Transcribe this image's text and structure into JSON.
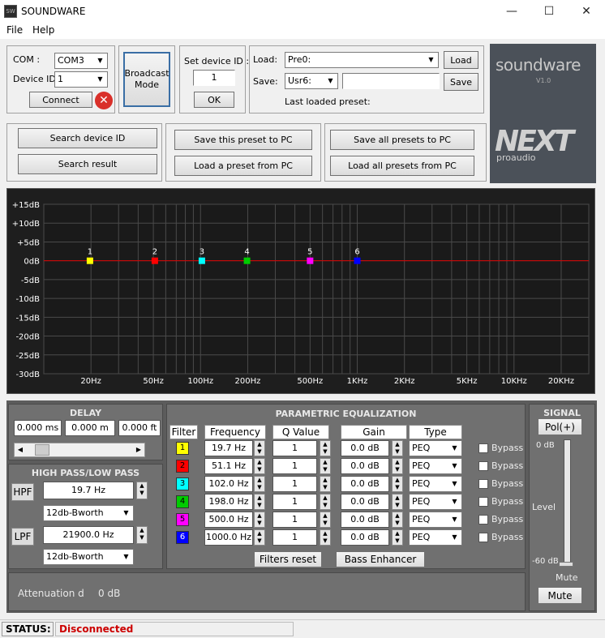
{
  "window": {
    "title": "SOUNDWARE",
    "minimize": "—",
    "maximize": "☐",
    "close": "✕",
    "icon": "app-icon"
  },
  "menu": {
    "file": "File",
    "help": "Help"
  },
  "connection": {
    "com_label": "COM :",
    "com_value": "COM3",
    "device_id_label": "Device ID:",
    "device_id_value": "1",
    "connect_label": "Connect",
    "broadcast_label": "Broadcast Mode"
  },
  "set_device": {
    "label": "Set device ID :",
    "value": "1",
    "ok": "OK"
  },
  "presets": {
    "load_label": "Load:",
    "load_value": "Pre0:",
    "load_btn": "Load",
    "save_label": "Save:",
    "save_value": "Usr6:",
    "save_name": "",
    "save_btn": "Save",
    "last_loaded": "Last loaded preset:"
  },
  "logo": {
    "brand": "soundware",
    "version": "V1.0",
    "next": "NEXT",
    "proaudio": "proaudio"
  },
  "actions": {
    "search_id": "Search device ID",
    "search_result": "Search result",
    "save_preset_pc": "Save this preset to PC",
    "load_preset_pc": "Load a preset from PC",
    "save_all_pc": "Save all presets to PC",
    "load_all_pc": "Load all presets from PC"
  },
  "chart_data": {
    "type": "line",
    "xscale": "log",
    "xlim": [
      10,
      30000
    ],
    "ylim": [
      -30,
      15
    ],
    "grid": true,
    "y_ticks": [
      "+15dB",
      "+10dB",
      "+5dB",
      "0dB",
      "-5dB",
      "-10dB",
      "-15dB",
      "-20dB",
      "-25dB",
      "-30dB"
    ],
    "y_tick_values": [
      15,
      10,
      5,
      0,
      -5,
      -10,
      -15,
      -20,
      -25,
      -30
    ],
    "x_ticks": [
      "20Hz",
      "50Hz",
      "100Hz",
      "200Hz",
      "500Hz",
      "1KHz",
      "2KHz",
      "5KHz",
      "10KHz",
      "20KHz"
    ],
    "x_tick_values": [
      20,
      50,
      100,
      200,
      500,
      1000,
      2000,
      5000,
      10000,
      20000
    ],
    "curve": {
      "color": "#dd0000",
      "values": [
        0,
        0
      ]
    },
    "points": [
      {
        "label": "1",
        "freq": 19.7,
        "gain": 0,
        "color": "#ffff00"
      },
      {
        "label": "2",
        "freq": 51.1,
        "gain": 0,
        "color": "#ff0000"
      },
      {
        "label": "3",
        "freq": 102.0,
        "gain": 0,
        "color": "#00ffff"
      },
      {
        "label": "4",
        "freq": 198.0,
        "gain": 0,
        "color": "#00cc00"
      },
      {
        "label": "5",
        "freq": 500.0,
        "gain": 0,
        "color": "#ff00ff"
      },
      {
        "label": "6",
        "freq": 1000.0,
        "gain": 0,
        "color": "#0000ff"
      }
    ]
  },
  "delay": {
    "title": "DELAY",
    "ms": "0.000 ms",
    "m": "0.000 m",
    "ft": "0.000 ft",
    "position": 0.08
  },
  "hplp": {
    "title": "HIGH PASS/LOW PASS",
    "hpf_label": "HPF",
    "hpf_value": "19.7 Hz",
    "hpf_type": "12db-Bworth",
    "lpf_label": "LPF",
    "lpf_value": "21900.0 Hz",
    "lpf_type": "12db-Bworth"
  },
  "attenuation": {
    "label": "Attenuation d",
    "value": "0 dB"
  },
  "peq": {
    "title": "PARAMETRIC EQUALIZATION",
    "headers": {
      "filter": "Filter",
      "frequency": "Frequency",
      "q": "Q Value",
      "gain": "Gain",
      "type": "Type"
    },
    "bypass_label": "Bypass",
    "rows": [
      {
        "num": "1",
        "color": "#ffff00",
        "freq": "19.7 Hz",
        "q": "1",
        "gain": "0.0 dB",
        "type": "PEQ"
      },
      {
        "num": "2",
        "color": "#ff0000",
        "freq": "51.1 Hz",
        "q": "1",
        "gain": "0.0 dB",
        "type": "PEQ"
      },
      {
        "num": "3",
        "color": "#00ffff",
        "freq": "102.0 Hz",
        "q": "1",
        "gain": "0.0 dB",
        "type": "PEQ"
      },
      {
        "num": "4",
        "color": "#00cc00",
        "freq": "198.0 Hz",
        "q": "1",
        "gain": "0.0 dB",
        "type": "PEQ"
      },
      {
        "num": "5",
        "color": "#ff00ff",
        "freq": "500.0 Hz",
        "q": "1",
        "gain": "0.0 dB",
        "type": "PEQ"
      },
      {
        "num": "6",
        "color": "#0000ff",
        "freq": "1000.0 Hz",
        "q": "1",
        "gain": "0.0 dB",
        "type": "PEQ"
      }
    ],
    "filters_reset": "Filters reset",
    "bass_enhancer": "Bass Enhancer"
  },
  "signal": {
    "title": "SIGNAL",
    "pol": "Pol(+)",
    "top": "0 dB",
    "level": "Level",
    "bottom": "-60 dB",
    "mute_label": "Mute",
    "mute_btn": "Mute",
    "level_value": 0
  },
  "status": {
    "label": "STATUS:",
    "value": "Disconnected",
    "color": "#cc0000"
  }
}
